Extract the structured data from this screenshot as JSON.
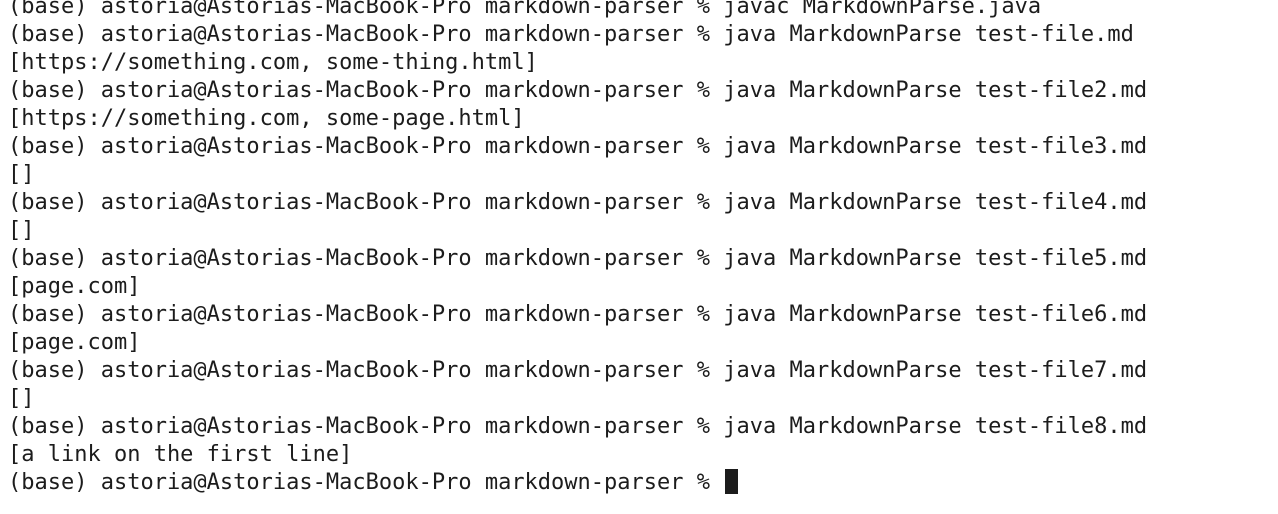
{
  "terminal": {
    "lines": [
      "(base) astoria@Astorias-MacBook-Pro markdown-parser % javac MarkdownParse.java",
      "(base) astoria@Astorias-MacBook-Pro markdown-parser % java MarkdownParse test-file.md",
      "[https://something.com, some-thing.html]",
      "(base) astoria@Astorias-MacBook-Pro markdown-parser % java MarkdownParse test-file2.md",
      "[https://something.com, some-page.html]",
      "(base) astoria@Astorias-MacBook-Pro markdown-parser % java MarkdownParse test-file3.md",
      "[]",
      "(base) astoria@Astorias-MacBook-Pro markdown-parser % java MarkdownParse test-file4.md",
      "[]",
      "(base) astoria@Astorias-MacBook-Pro markdown-parser % java MarkdownParse test-file5.md",
      "[page.com]",
      "(base) astoria@Astorias-MacBook-Pro markdown-parser % java MarkdownParse test-file6.md",
      "[page.com]",
      "(base) astoria@Astorias-MacBook-Pro markdown-parser % java MarkdownParse test-file7.md",
      "[]",
      "(base) astoria@Astorias-MacBook-Pro markdown-parser % java MarkdownParse test-file8.md",
      "[a link on the first line]"
    ],
    "prompt": "(base) astoria@Astorias-MacBook-Pro markdown-parser % ",
    "background_color": "#ffffff",
    "text_color": "#1c1c1c"
  }
}
